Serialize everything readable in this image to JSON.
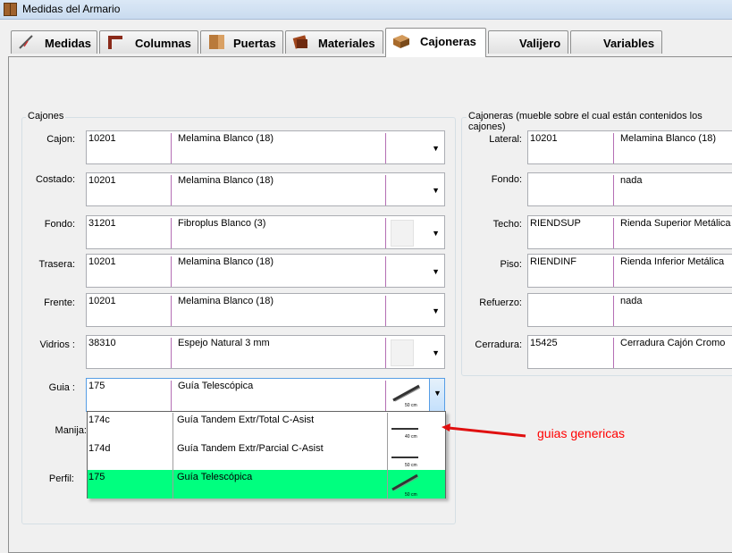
{
  "window": {
    "title": "Medidas del Armario"
  },
  "tabs": [
    {
      "label": "Medidas",
      "icon": "ruler-icon"
    },
    {
      "label": "Columnas",
      "icon": "column-icon"
    },
    {
      "label": "Puertas",
      "icon": "door-icon"
    },
    {
      "label": "Materiales",
      "icon": "materials-icon"
    },
    {
      "label": "Cajoneras",
      "icon": "drawer-icon",
      "active": true
    },
    {
      "label": "Valijero"
    },
    {
      "label": "Variables"
    }
  ],
  "cajones": {
    "title": "Cajones",
    "rows": [
      {
        "label": "Cajon:",
        "code": "10201",
        "desc": "Melamina Blanco (18)"
      },
      {
        "label": "Costado:",
        "code": "10201",
        "desc": "Melamina Blanco (18)"
      },
      {
        "label": "Fondo:",
        "code": "31201",
        "desc": "Fibroplus Blanco (3)"
      },
      {
        "label": "Trasera:",
        "code": "10201",
        "desc": "Melamina Blanco (18)"
      },
      {
        "label": "Frente:",
        "code": "10201",
        "desc": "Melamina Blanco (18)"
      },
      {
        "label": "Vidrios :",
        "code": "38310",
        "desc": "Espejo Natural 3 mm"
      },
      {
        "label": "Guia :",
        "code": "175",
        "desc": "Guía Telescópica",
        "thumb_caption": "50 cm"
      }
    ],
    "manija_label": "Manija:",
    "perfil_label": "Perfil:"
  },
  "guia_dropdown": {
    "items": [
      {
        "code": "174c",
        "desc": "Guía Tandem Extr/Total C-Asist",
        "caption": "40 cm"
      },
      {
        "code": "174d",
        "desc": "Guía Tandem Extr/Parcial C-Asist",
        "caption": "50 cm"
      },
      {
        "code": "175",
        "desc": "Guía Telescópica",
        "caption": "50 cm",
        "selected": true
      }
    ],
    "selected_color": "#00ff7f"
  },
  "cajoneras": {
    "title": "Cajoneras (mueble sobre el cual están contenidos los cajones)",
    "rows": [
      {
        "label": "Lateral:",
        "code": "10201",
        "desc": "Melamina Blanco (18)"
      },
      {
        "label": "Fondo:",
        "code": "",
        "desc": "nada"
      },
      {
        "label": "Techo:",
        "code": "RIENDSUP",
        "desc": "Rienda Superior Metálica"
      },
      {
        "label": "Piso:",
        "code": "RIENDINF",
        "desc": "Rienda Inferior Metálica"
      },
      {
        "label": "Refuerzo:",
        "code": "",
        "desc": "nada"
      },
      {
        "label": "Cerradura:",
        "code": "15425",
        "desc": "Cerradura Cajón Cromo"
      }
    ]
  },
  "annotation": {
    "text": "guias genericas",
    "color": "#ff0000"
  }
}
